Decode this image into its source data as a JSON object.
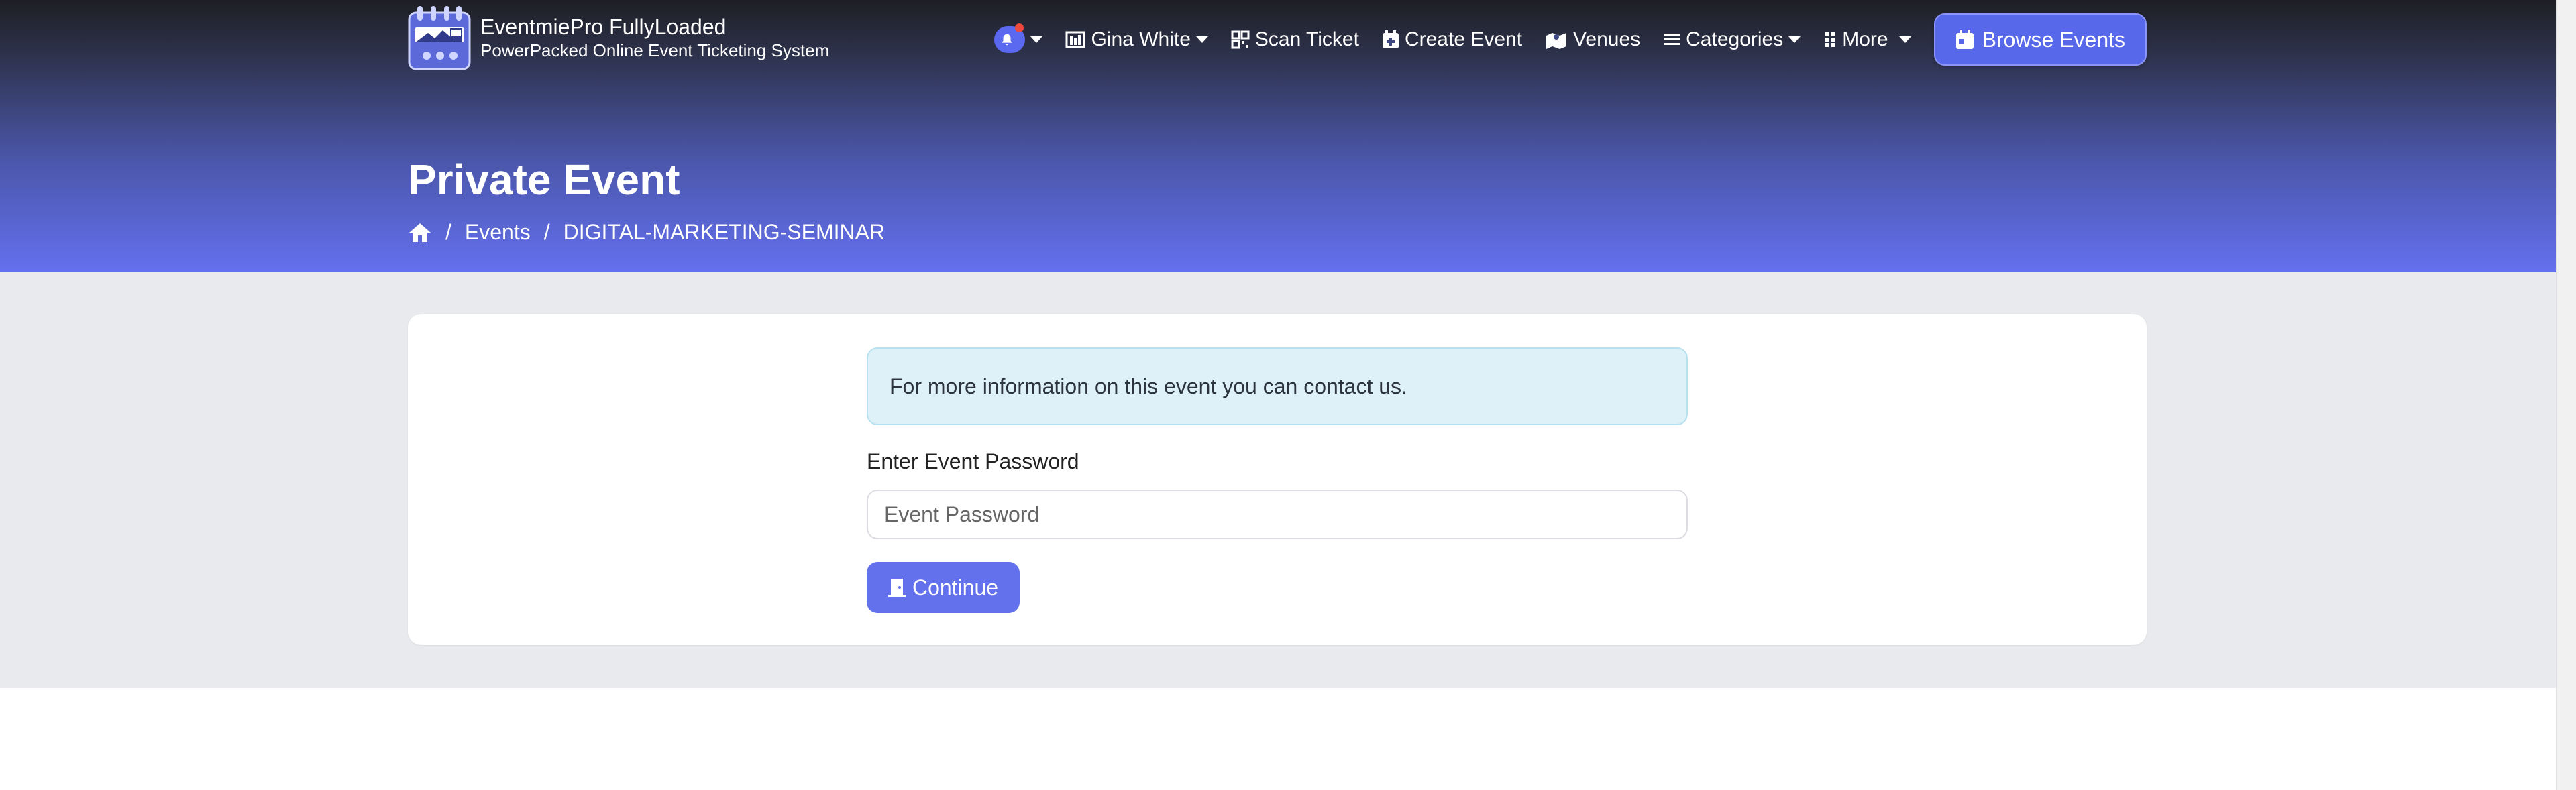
{
  "brand": {
    "title": "EventmiePro FullyLoaded",
    "subtitle": "PowerPacked Online Event Ticketing System"
  },
  "nav": {
    "user_label": "Gina White",
    "scan_ticket": "Scan Ticket",
    "create_event": "Create Event",
    "venues": "Venues",
    "categories": "Categories",
    "more": "More",
    "browse_events": "Browse Events"
  },
  "page": {
    "title": "Private Event",
    "breadcrumb": [
      "Events",
      "DIGITAL-MARKETING-SEMINAR"
    ]
  },
  "form": {
    "alert": "For more information on this event you can contact us.",
    "password_label": "Enter Event Password",
    "password_placeholder": "Event Password",
    "password_value": "",
    "continue_label": "Continue"
  },
  "colors": {
    "accent": "#6371ed",
    "alert_bg": "#def1f9",
    "notification_dot": "#ef4a3c"
  },
  "icons": [
    "logo-calendar-icon",
    "bell-icon",
    "user-board-icon",
    "qrcode-icon",
    "calendar-plus-icon",
    "map-icon",
    "list-icon",
    "grid-icon",
    "calendar-icon",
    "home-icon",
    "door-icon"
  ]
}
